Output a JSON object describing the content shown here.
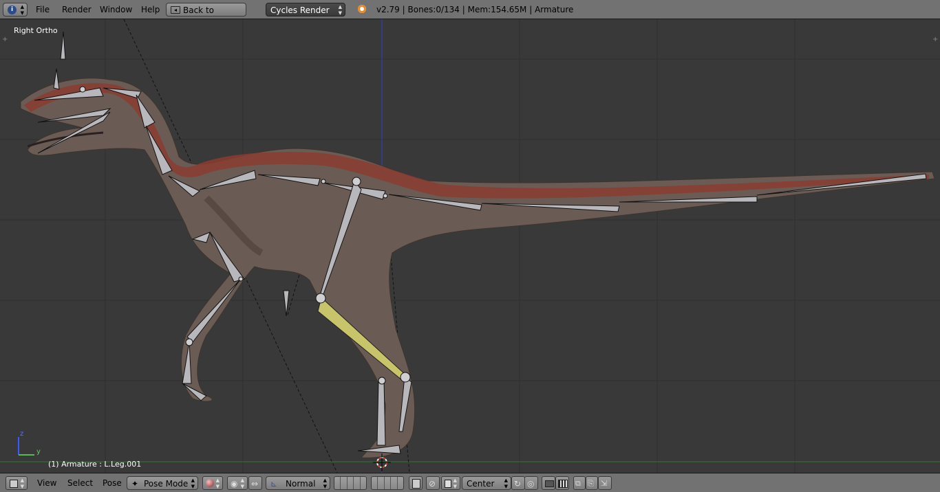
{
  "topbar": {
    "menu": [
      "File",
      "Render",
      "Window",
      "Help"
    ],
    "back_label": "Back to Previous",
    "engine": "Cycles Render",
    "stats": "v2.79 | Bones:0/134  | Mem:154.65M | Armature"
  },
  "viewport": {
    "view_name": "Right Ortho",
    "object_info": "(1) Armature : L.Leg.001",
    "axis_z": "z",
    "axis_y": "y"
  },
  "bottombar": {
    "menu": [
      "View",
      "Select",
      "Pose"
    ],
    "mode": "Pose Mode",
    "shading": "Normal",
    "pivot": "Center"
  },
  "colors": {
    "header_bg": "#727272",
    "viewport_bg": "#393939",
    "selected_bone": "#c8c46a",
    "bone": "#b8b8bc",
    "ground_line": "#2f7a2f",
    "z_axis": "#2f3fc8"
  }
}
